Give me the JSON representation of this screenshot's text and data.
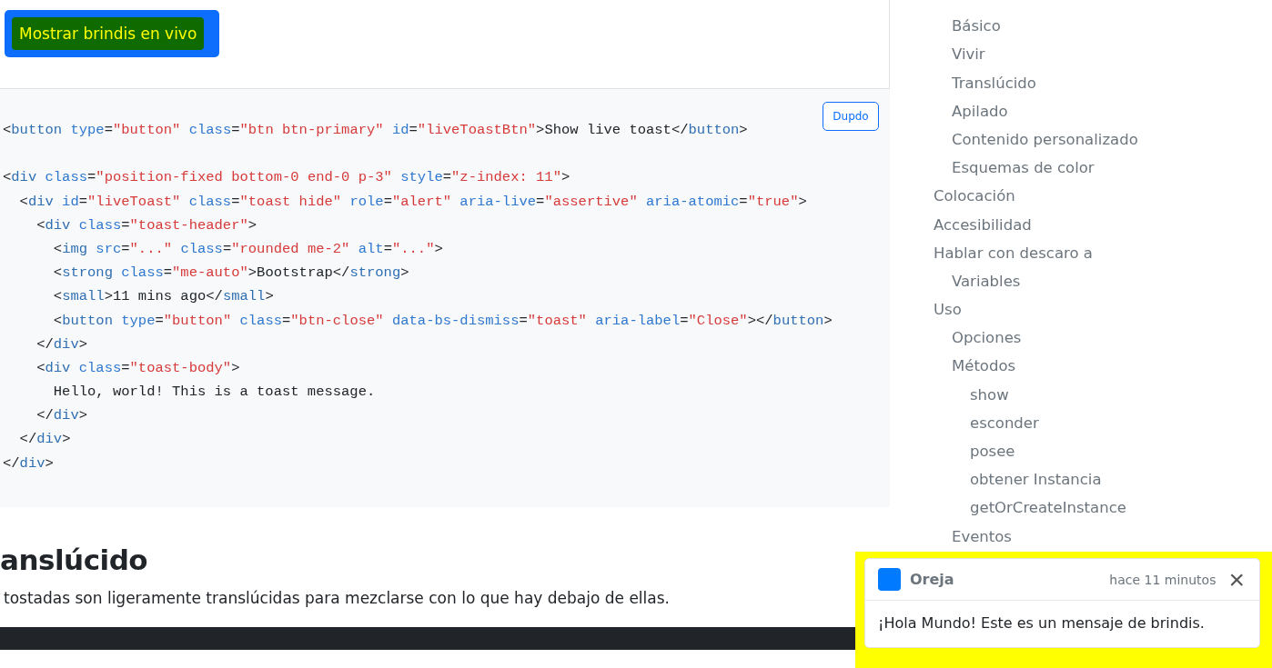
{
  "demo_button": {
    "label": "Mostrar brindis en vivo"
  },
  "code_block": {
    "copy_button": "Dupdo",
    "lines": [
      {
        "tokens": [
          {
            "kind": "plain",
            "text": "<"
          },
          {
            "kind": "tag",
            "text": "button"
          },
          {
            "kind": "attr",
            "text": " type"
          },
          {
            "kind": "plain",
            "text": "="
          },
          {
            "kind": "value",
            "text": "\"button\""
          },
          {
            "kind": "attr",
            "text": " class"
          },
          {
            "kind": "plain",
            "text": "="
          },
          {
            "kind": "value",
            "text": "\"btn btn-primary\""
          },
          {
            "kind": "attr",
            "text": " id"
          },
          {
            "kind": "plain",
            "text": "="
          },
          {
            "kind": "value",
            "text": "\"liveToastBtn\""
          },
          {
            "kind": "plain",
            "text": ">Show live toast</"
          },
          {
            "kind": "tag",
            "text": "button"
          },
          {
            "kind": "plain",
            "text": ">"
          }
        ]
      },
      {
        "blank_before": true,
        "tokens": [
          {
            "kind": "plain",
            "text": "<"
          },
          {
            "kind": "tag",
            "text": "div"
          },
          {
            "kind": "attr",
            "text": " class"
          },
          {
            "kind": "plain",
            "text": "="
          },
          {
            "kind": "value",
            "text": "\"position-fixed bottom-0 end-0 p-3\""
          },
          {
            "kind": "attr",
            "text": " style"
          },
          {
            "kind": "plain",
            "text": "="
          },
          {
            "kind": "value",
            "text": "\"z-index: 11\""
          },
          {
            "kind": "plain",
            "text": ">"
          }
        ]
      },
      {
        "tokens": [
          {
            "kind": "plain",
            "text": "  <"
          },
          {
            "kind": "tag",
            "text": "div"
          },
          {
            "kind": "attr",
            "text": " id"
          },
          {
            "kind": "plain",
            "text": "="
          },
          {
            "kind": "value",
            "text": "\"liveToast\""
          },
          {
            "kind": "attr",
            "text": " class"
          },
          {
            "kind": "plain",
            "text": "="
          },
          {
            "kind": "value",
            "text": "\"toast hide\""
          },
          {
            "kind": "attr",
            "text": " role"
          },
          {
            "kind": "plain",
            "text": "="
          },
          {
            "kind": "value",
            "text": "\"alert\""
          },
          {
            "kind": "attr",
            "text": " aria-live"
          },
          {
            "kind": "plain",
            "text": "="
          },
          {
            "kind": "value",
            "text": "\"assertive\""
          },
          {
            "kind": "attr",
            "text": " aria-atomic"
          },
          {
            "kind": "plain",
            "text": "="
          },
          {
            "kind": "value",
            "text": "\"true\""
          },
          {
            "kind": "plain",
            "text": ">"
          }
        ]
      },
      {
        "tokens": [
          {
            "kind": "plain",
            "text": "    <"
          },
          {
            "kind": "tag",
            "text": "div"
          },
          {
            "kind": "attr",
            "text": " class"
          },
          {
            "kind": "plain",
            "text": "="
          },
          {
            "kind": "value",
            "text": "\"toast-header\""
          },
          {
            "kind": "plain",
            "text": ">"
          }
        ]
      },
      {
        "tokens": [
          {
            "kind": "plain",
            "text": "      <"
          },
          {
            "kind": "tag",
            "text": "img"
          },
          {
            "kind": "attr",
            "text": " src"
          },
          {
            "kind": "plain",
            "text": "="
          },
          {
            "kind": "value",
            "text": "\"...\""
          },
          {
            "kind": "attr",
            "text": " class"
          },
          {
            "kind": "plain",
            "text": "="
          },
          {
            "kind": "value",
            "text": "\"rounded me-2\""
          },
          {
            "kind": "attr",
            "text": " alt"
          },
          {
            "kind": "plain",
            "text": "="
          },
          {
            "kind": "value",
            "text": "\"...\""
          },
          {
            "kind": "plain",
            "text": ">"
          }
        ]
      },
      {
        "tokens": [
          {
            "kind": "plain",
            "text": "      <"
          },
          {
            "kind": "tag",
            "text": "strong"
          },
          {
            "kind": "attr",
            "text": " class"
          },
          {
            "kind": "plain",
            "text": "="
          },
          {
            "kind": "value",
            "text": "\"me-auto\""
          },
          {
            "kind": "plain",
            "text": ">Bootstrap</"
          },
          {
            "kind": "tag",
            "text": "strong"
          },
          {
            "kind": "plain",
            "text": ">"
          }
        ]
      },
      {
        "tokens": [
          {
            "kind": "plain",
            "text": "      <"
          },
          {
            "kind": "tag",
            "text": "small"
          },
          {
            "kind": "plain",
            "text": ">11 mins ago</"
          },
          {
            "kind": "tag",
            "text": "small"
          },
          {
            "kind": "plain",
            "text": ">"
          }
        ]
      },
      {
        "tokens": [
          {
            "kind": "plain",
            "text": "      <"
          },
          {
            "kind": "tag",
            "text": "button"
          },
          {
            "kind": "attr",
            "text": " type"
          },
          {
            "kind": "plain",
            "text": "="
          },
          {
            "kind": "value",
            "text": "\"button\""
          },
          {
            "kind": "attr",
            "text": " class"
          },
          {
            "kind": "plain",
            "text": "="
          },
          {
            "kind": "value",
            "text": "\"btn-close\""
          },
          {
            "kind": "attr",
            "text": " data-bs-dismiss"
          },
          {
            "kind": "plain",
            "text": "="
          },
          {
            "kind": "value",
            "text": "\"toast\""
          },
          {
            "kind": "attr",
            "text": " aria-label"
          },
          {
            "kind": "plain",
            "text": "="
          },
          {
            "kind": "value",
            "text": "\"Close\""
          },
          {
            "kind": "plain",
            "text": "></"
          },
          {
            "kind": "tag",
            "text": "button"
          },
          {
            "kind": "plain",
            "text": ">"
          }
        ]
      },
      {
        "tokens": [
          {
            "kind": "plain",
            "text": "    </"
          },
          {
            "kind": "tag",
            "text": "div"
          },
          {
            "kind": "plain",
            "text": ">"
          }
        ]
      },
      {
        "tokens": [
          {
            "kind": "plain",
            "text": "    <"
          },
          {
            "kind": "tag",
            "text": "div"
          },
          {
            "kind": "attr",
            "text": " class"
          },
          {
            "kind": "plain",
            "text": "="
          },
          {
            "kind": "value",
            "text": "\"toast-body\""
          },
          {
            "kind": "plain",
            "text": ">"
          }
        ]
      },
      {
        "tokens": [
          {
            "kind": "plain",
            "text": "      Hello, world! This is a toast message."
          }
        ]
      },
      {
        "tokens": [
          {
            "kind": "plain",
            "text": "    </"
          },
          {
            "kind": "tag",
            "text": "div"
          },
          {
            "kind": "plain",
            "text": ">"
          }
        ]
      },
      {
        "tokens": [
          {
            "kind": "plain",
            "text": "  </"
          },
          {
            "kind": "tag",
            "text": "div"
          },
          {
            "kind": "plain",
            "text": ">"
          }
        ]
      },
      {
        "tokens": [
          {
            "kind": "plain",
            "text": "</"
          },
          {
            "kind": "tag",
            "text": "div"
          },
          {
            "kind": "plain",
            "text": ">"
          }
        ]
      }
    ]
  },
  "section": {
    "heading": "anslúcido",
    "text": "tostadas son ligeramente translúcidas para mezclarse con lo que hay debajo de ellas."
  },
  "sidebar": {
    "items": [
      {
        "children": [
          {
            "label": "Básico"
          },
          {
            "label": "Vivir"
          },
          {
            "label": "Translúcido"
          },
          {
            "label": "Apilado"
          },
          {
            "label": "Contenido personalizado"
          },
          {
            "label": "Esquemas de color"
          }
        ]
      },
      {
        "label": "Colocación"
      },
      {
        "label": "Accesibilidad"
      },
      {
        "label": "Hablar con descaro a",
        "children": [
          {
            "label": "Variables"
          }
        ]
      },
      {
        "label": "Uso",
        "children": [
          {
            "label": "Opciones"
          },
          {
            "label": "Métodos",
            "children": [
              {
                "label": "show"
              },
              {
                "label": "esconder"
              },
              {
                "label": "posee"
              },
              {
                "label": "obtener Instancia"
              },
              {
                "label": "getOrCreateInstance"
              }
            ]
          },
          {
            "label": "Eventos"
          }
        ]
      }
    ]
  },
  "toast": {
    "title": "Oreja",
    "time": "hace 11 minutos",
    "close": "×",
    "body": "¡Hola Mundo! Este es un mensaje de brindis."
  }
}
